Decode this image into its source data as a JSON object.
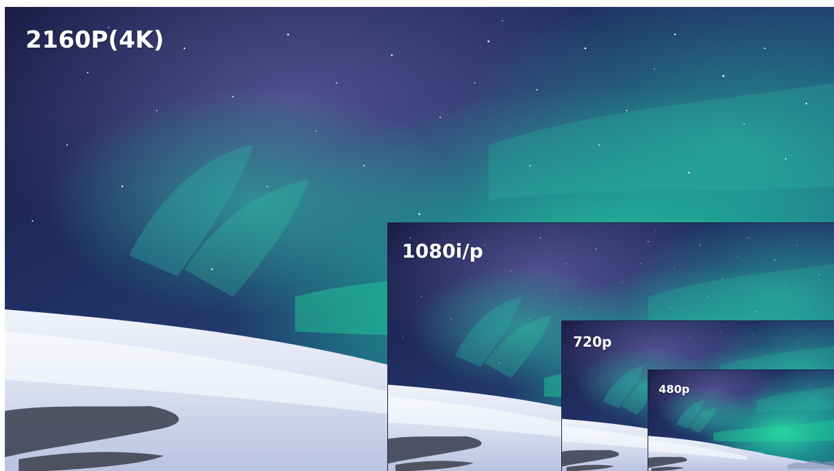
{
  "labels": {
    "res_4k": "2160P(4K)",
    "res_1080": "1080i/p",
    "res_720": "720p",
    "res_480": "480p"
  },
  "colors": {
    "sky_top": "#1c1f4a",
    "sky_mid": "#234a7a",
    "aurora_green": "#21d49a",
    "aurora_teal": "#1aa6a0",
    "aurora_violet": "#6a5fa8",
    "snow": "#e8ecf7",
    "snow_shadow": "#aab4d4",
    "rock": "#3a3b48",
    "label_text": "#ffffff"
  }
}
